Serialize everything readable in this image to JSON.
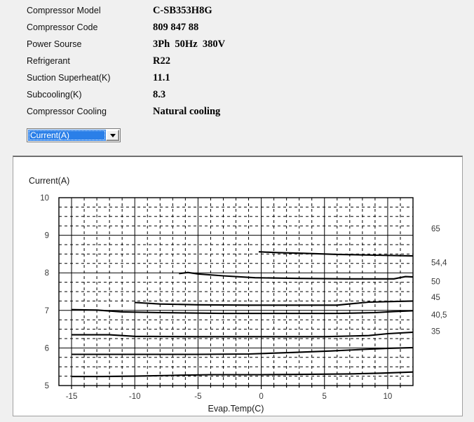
{
  "specs": {
    "rows": [
      {
        "label": "Compressor  Model",
        "value": "C-SB353H8G"
      },
      {
        "label": "Compressor Code",
        "value": "809 847 88"
      },
      {
        "label": "Power Sourse",
        "value": "3Ph  50Hz  380V"
      },
      {
        "label": "Refrigerant",
        "value": "R22"
      },
      {
        "label": "Suction Superheat(K)",
        "value": "11.1"
      },
      {
        "label": "Subcooling(K)",
        "value": "8.3"
      },
      {
        "label": "Compressor Cooling",
        "value": "Natural cooling"
      }
    ]
  },
  "series_select": {
    "value": "Current(A)",
    "options": [
      "Current(A)"
    ],
    "arrow_icon": "chevron-down-icon"
  },
  "chart_data": {
    "type": "line",
    "title": "",
    "ylabel": "Current(A)",
    "xlabel": "Evap.Temp(C)",
    "xlim": [
      -16,
      12
    ],
    "ylim": [
      5,
      10
    ],
    "xticks": [
      -15,
      -10,
      -5,
      0,
      5,
      10
    ],
    "yticks": [
      5,
      6,
      7,
      8,
      9,
      10
    ],
    "grid": "major-solid-minor-dashed",
    "minor_x_step": 1,
    "minor_y_step": 0.25,
    "legend": "right-end-labels",
    "series": [
      {
        "name": "65",
        "label": "65",
        "label_value": 9.18,
        "x": [
          -0.2,
          1.2,
          3.3,
          6.0,
          9.0,
          12.0
        ],
        "values": [
          8.56,
          8.54,
          8.52,
          8.49,
          8.47,
          8.45
        ]
      },
      {
        "name": "54,4",
        "label": "54,4",
        "label_value": 8.27,
        "x": [
          -6.5,
          -5.8,
          -5.0,
          -3.0,
          -0.5,
          3.0,
          7.0,
          10.5,
          11.4,
          12.0
        ],
        "values": [
          7.98,
          8.01,
          7.97,
          7.92,
          7.87,
          7.85,
          7.84,
          7.84,
          7.9,
          7.89
        ]
      },
      {
        "name": "50",
        "label": "50",
        "label_value": 7.77,
        "x": [],
        "values": []
      },
      {
        "name": "45",
        "label": "45",
        "label_value": 7.35,
        "x": [
          -10.0,
          -8.0,
          -5.0,
          -1.0,
          3.0,
          6.0,
          8.5,
          12.0
        ],
        "values": [
          7.21,
          7.17,
          7.15,
          7.14,
          7.14,
          7.14,
          7.22,
          7.25
        ]
      },
      {
        "name": "40,5",
        "label": "40,5",
        "label_value": 6.88,
        "x": [
          -15.0,
          -13.0,
          -11.0,
          -8.0,
          -3.0,
          2.0,
          6.0,
          9.0,
          10.5,
          12.0
        ],
        "values": [
          7.02,
          7.01,
          6.96,
          6.94,
          6.92,
          6.92,
          6.92,
          6.94,
          6.97,
          6.99
        ]
      },
      {
        "name": "35",
        "label": "35",
        "label_value": 6.45,
        "x": [
          -15.0,
          -12.0,
          -10.0,
          -5.0,
          0.0,
          5.0,
          8.5,
          10.0,
          12.0
        ],
        "values": [
          6.35,
          6.35,
          6.31,
          6.3,
          6.3,
          6.3,
          6.33,
          6.38,
          6.42
        ]
      },
      {
        "name": "lower-a",
        "label": "",
        "label_value": null,
        "x": [
          -15.0,
          -12.0,
          -9.0,
          -5.0,
          -1.0,
          2.5,
          5.5,
          8.0,
          10.0,
          12.0
        ],
        "values": [
          5.83,
          5.83,
          5.83,
          5.83,
          5.84,
          5.88,
          5.92,
          5.96,
          5.99,
          6.01
        ]
      },
      {
        "name": "lower-b",
        "label": "",
        "label_value": null,
        "x": [
          -15.0,
          -12.5,
          -10.0,
          -7.0,
          -4.0,
          0.0,
          4.0,
          7.0,
          9.5,
          12.0
        ],
        "values": [
          5.24,
          5.24,
          5.25,
          5.27,
          5.29,
          5.29,
          5.3,
          5.31,
          5.33,
          5.36
        ]
      }
    ]
  }
}
